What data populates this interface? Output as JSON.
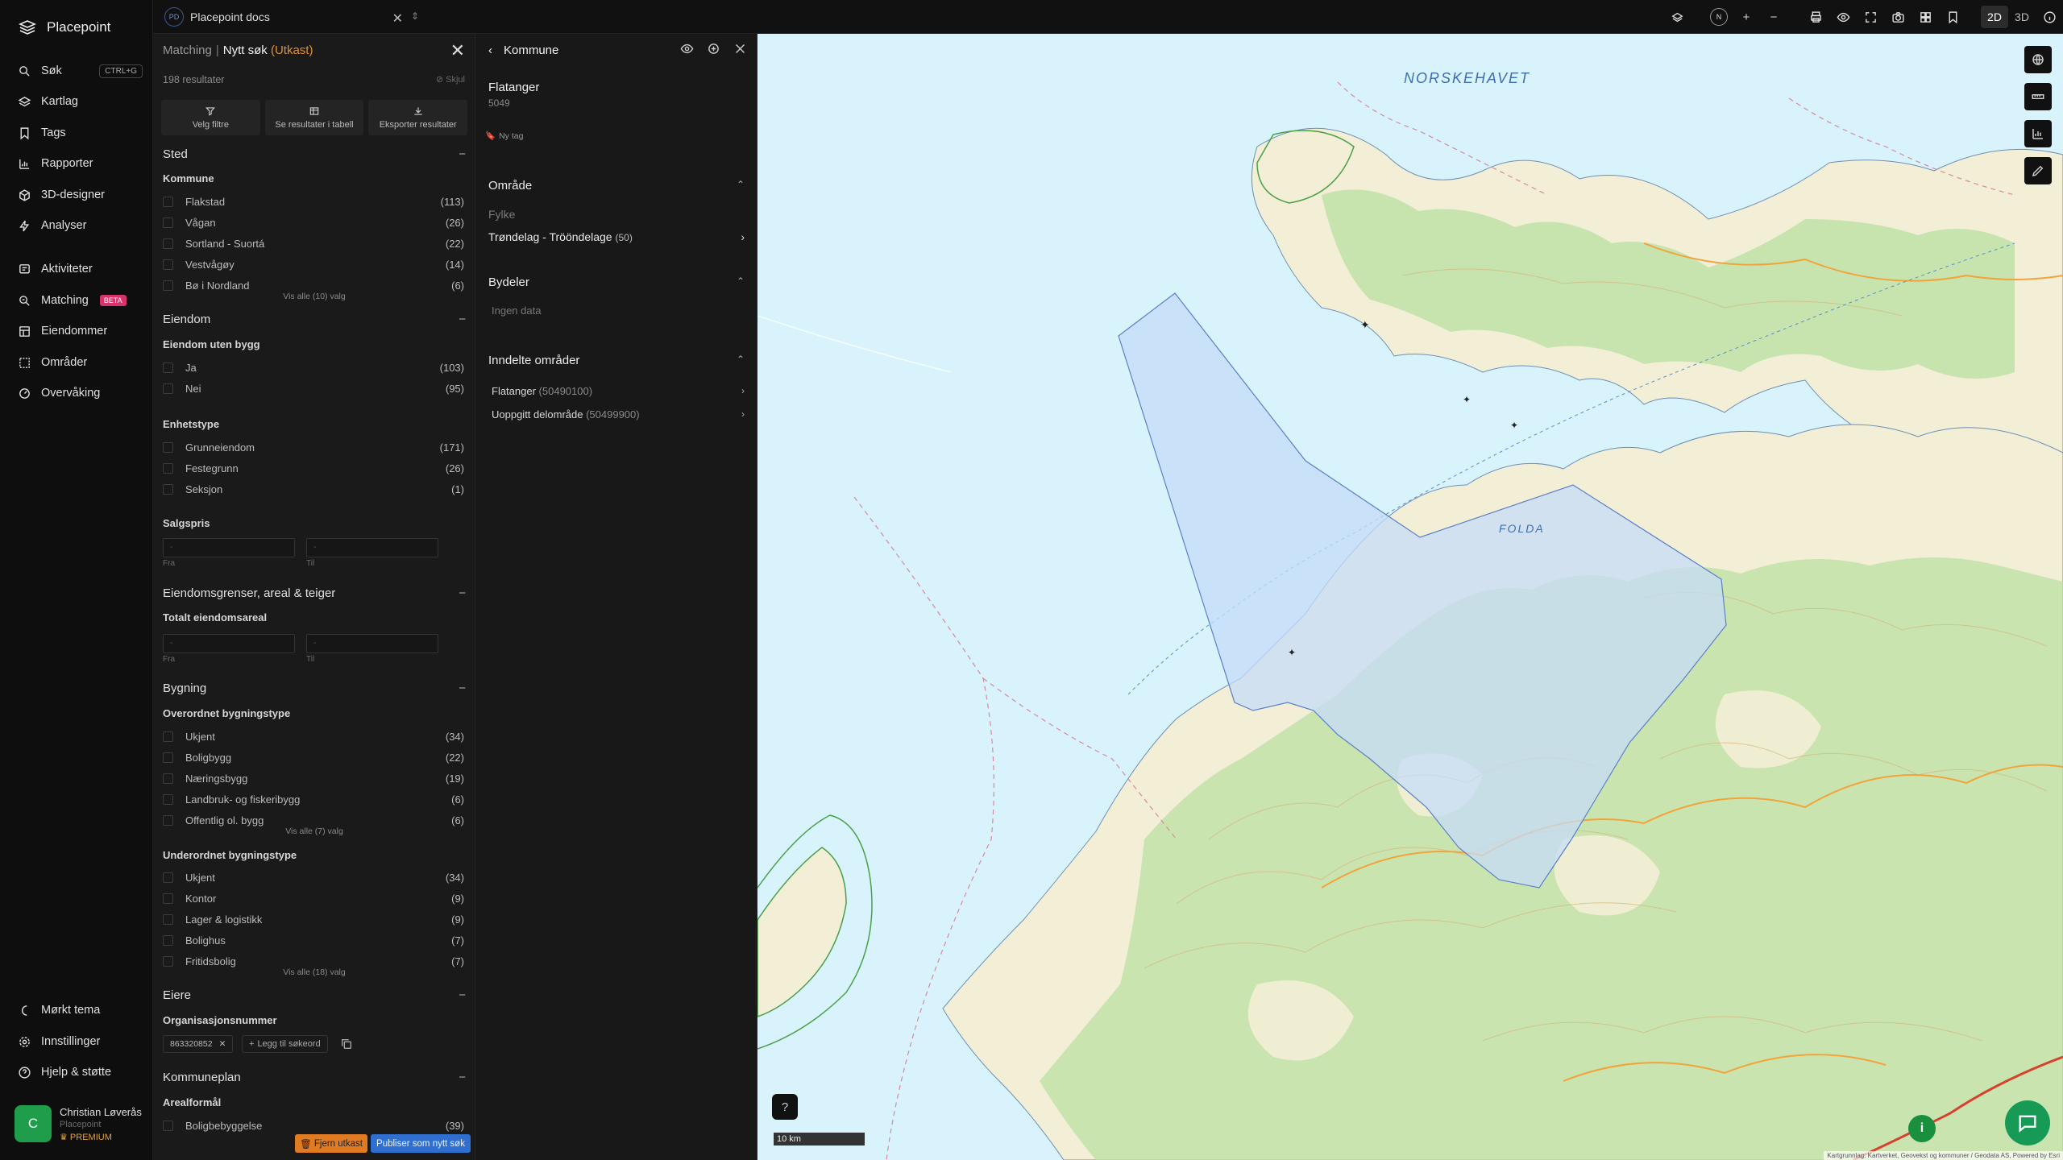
{
  "nav": {
    "brand": "Placepoint",
    "items": [
      {
        "label": "Søk",
        "shortcut": "CTRL+G"
      },
      {
        "label": "Kartlag"
      },
      {
        "label": "Tags"
      },
      {
        "label": "Rapporter"
      },
      {
        "label": "3D-designer"
      },
      {
        "label": "Analyser"
      },
      {
        "label": "Aktiviteter"
      },
      {
        "label": "Matching",
        "badge": "BETA"
      },
      {
        "label": "Eiendommer"
      },
      {
        "label": "Områder"
      },
      {
        "label": "Overvåking"
      }
    ],
    "bottom": [
      {
        "label": "Mørkt tema"
      },
      {
        "label": "Innstillinger"
      },
      {
        "label": "Hjelp & støtte"
      }
    ],
    "user": {
      "initial": "C",
      "name": "Christian Løverås",
      "org": "Placepoint",
      "plan": "PREMIUM"
    }
  },
  "topbar": {
    "doc_badge": "PD",
    "doc_title": "Placepoint docs",
    "north": "N",
    "view_2d": "2D",
    "view_3d": "3D"
  },
  "search": {
    "crumb_parent": "Matching",
    "crumb_current": "Nytt søk",
    "crumb_state": "(Utkast)",
    "result_count": "198 resultater",
    "hide_label": "Skjul",
    "actions": [
      "Velg filtre",
      "Se resultater i tabell",
      "Eksporter resultater"
    ],
    "sted": {
      "title": "Sted",
      "kommune_label": "Kommune",
      "kommune": [
        {
          "label": "Flakstad",
          "count": "(113)"
        },
        {
          "label": "Vågan",
          "count": "(26)"
        },
        {
          "label": "Sortland - Suortá",
          "count": "(22)"
        },
        {
          "label": "Vestvågøy",
          "count": "(14)"
        },
        {
          "label": "Bø i Nordland",
          "count": "(6)"
        }
      ],
      "show_all": "Vis alle (10) valg"
    },
    "eiendom": {
      "title": "Eiendom",
      "uten_bygg_label": "Eiendom uten bygg",
      "uten_bygg": [
        {
          "label": "Ja",
          "count": "(103)"
        },
        {
          "label": "Nei",
          "count": "(95)"
        }
      ],
      "enhetstype_label": "Enhetstype",
      "enhetstype": [
        {
          "label": "Grunneiendom",
          "count": "(171)"
        },
        {
          "label": "Festegrunn",
          "count": "(26)"
        },
        {
          "label": "Seksjon",
          "count": "(1)"
        }
      ],
      "salgspris_label": "Salgspris",
      "from_label": "Fra",
      "to_label": "Til",
      "input_placeholder": "-"
    },
    "grenser": {
      "title": "Eiendomsgrenser, areal & teiger",
      "areal_label": "Totalt eiendomsareal"
    },
    "bygning": {
      "title": "Bygning",
      "over_label": "Overordnet bygningstype",
      "over": [
        {
          "label": "Ukjent",
          "count": "(34)"
        },
        {
          "label": "Boligbygg",
          "count": "(22)"
        },
        {
          "label": "Næringsbygg",
          "count": "(19)"
        },
        {
          "label": "Landbruk- og fiskeribygg",
          "count": "(6)"
        },
        {
          "label": "Offentlig ol. bygg",
          "count": "(6)"
        }
      ],
      "over_show_all": "Vis alle (7) valg",
      "under_label": "Underordnet bygningstype",
      "under": [
        {
          "label": "Ukjent",
          "count": "(34)"
        },
        {
          "label": "Kontor",
          "count": "(9)"
        },
        {
          "label": "Lager & logistikk",
          "count": "(9)"
        },
        {
          "label": "Bolighus",
          "count": "(7)"
        },
        {
          "label": "Fritidsbolig",
          "count": "(7)"
        }
      ],
      "under_show_all": "Vis alle (18) valg"
    },
    "eiere": {
      "title": "Eiere",
      "org_label": "Organisasjonsnummer",
      "chip": "863320852",
      "add_keyword": "Legg til søkeord"
    },
    "kommuneplan": {
      "title": "Kommuneplan",
      "arealformal_label": "Arealformål",
      "partial_item": "Boligbebyggelse",
      "partial_count": "(39)"
    },
    "remove_draft": "Fjern utkast",
    "publish": "Publiser som nytt søk"
  },
  "detail": {
    "header": "Kommune",
    "name": "Flatanger",
    "code": "5049",
    "new_tag": "Ny tag",
    "omrade": {
      "title": "Område",
      "fylke_label": "Fylke",
      "fylke_name": "Trøndelag - Trööndelage",
      "fylke_count": "(50)"
    },
    "bydeler": {
      "title": "Bydeler",
      "empty": "Ingen data"
    },
    "inndelte": {
      "title": "Inndelte områder",
      "items": [
        {
          "name": "Flatanger",
          "id": "(50490100)"
        },
        {
          "name": "Uoppgitt delområde",
          "id": "(50499900)"
        }
      ]
    }
  },
  "map": {
    "labels": [
      "NORSKEHAVET",
      "FOLDA"
    ],
    "scale": "10 km",
    "attribution": "Kartgrunnlag: Kartverket, Geovekst og kommuner / Geodata AS, Powered by Esri",
    "colors": {
      "sea": "#d8f3fb",
      "land": "#f3eed6",
      "forest": "#b8e0a0",
      "selection": "#c6dcf8",
      "selection_stroke": "#5a80c8",
      "contour": "#d6b57a"
    }
  }
}
